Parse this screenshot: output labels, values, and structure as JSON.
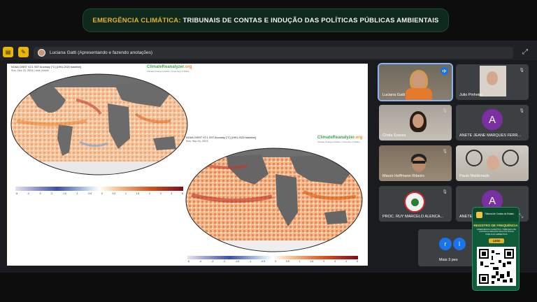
{
  "banner": {
    "highlight": "EMERGÊNCIA CLIMÁTICA:",
    "rest": " TRIBUNAIS DE CONTAS E INDUÇÃO DAS POLÍTICAS PÚBLICAS AMBIENTAIS"
  },
  "topbar": {
    "presenter_text": "Luciana Gatti (Apresentando e fazendo anotações)"
  },
  "slide": {
    "map1": {
      "title": "NOAA OISST V2.1 SST Anomaly (°C) [1991-2020 baseline]",
      "date": "Sun, Dec 22, 2024 | Unit: Kelvin",
      "logo_main": "ClimateReanalyzer",
      "logo_org": ".org",
      "logo_sub": "Climate Change Institute | University of Maine",
      "ticks": [
        "-5",
        "-4",
        "-3",
        "-2",
        "-1.5",
        "-1",
        "-0.5",
        "0",
        "0.5",
        "1",
        "1.5",
        "2",
        "3",
        "4",
        "5"
      ]
    },
    "map2": {
      "title": "NOAA OISST V2.1 SST Anomaly (°C) [1991-2020 baseline]",
      "date": "Sun, Sep 10, 2023",
      "logo_main": "ClimateReanalyzer",
      "logo_org": ".org",
      "logo_sub": "Climate Change Institute | University of Maine",
      "ticks": [
        "-5",
        "-4",
        "-3",
        "-2",
        "-1.5",
        "-1",
        "-0.5",
        "0",
        "0.5",
        "1",
        "1.5",
        "2",
        "3",
        "4",
        "5"
      ]
    }
  },
  "participants": [
    {
      "name": "Luciana Gatti"
    },
    {
      "name": "Julio Pinheiro"
    },
    {
      "name": "Cíntia Soares"
    },
    {
      "name": "ANETE JEANE MARQUES FERR...",
      "letter": "A"
    },
    {
      "name": "Mauro Hoffmann Ribeiro"
    },
    {
      "name": "Paulo Maldonado"
    },
    {
      "name": "PROC. RUY MARCELO ALENCA..."
    },
    {
      "name": "ANETE...",
      "letter": "A"
    }
  ],
  "more": {
    "label": "Mais 3 pes",
    "initials": [
      "r",
      "l"
    ]
  },
  "cert": {
    "org": "Tribunal de Contas do Estado",
    "title": "REGISTRO DE FREQUÊNCIA",
    "desc": "EMERGÊNCIA CLIMÁTICA: TRIBUNAIS DE CONTAS E INDUÇÃO DAS POLÍTICAS PÚBLICAS AMBIENTAIS",
    "date": "13/02"
  },
  "colors": {
    "banner_bg": "#0f2a1c",
    "accent_gold": "#e3b22a",
    "meet_bg": "#1a1b1e",
    "tile_bg": "#3c4043",
    "active_outline": "#8ab4f8",
    "avatar_purple": "#7b2fa3"
  },
  "icons": [
    "folder-icon",
    "notes-icon",
    "exit-presentation-icon",
    "mic-off-icon",
    "audio-level-icon",
    "expand-icon"
  ]
}
